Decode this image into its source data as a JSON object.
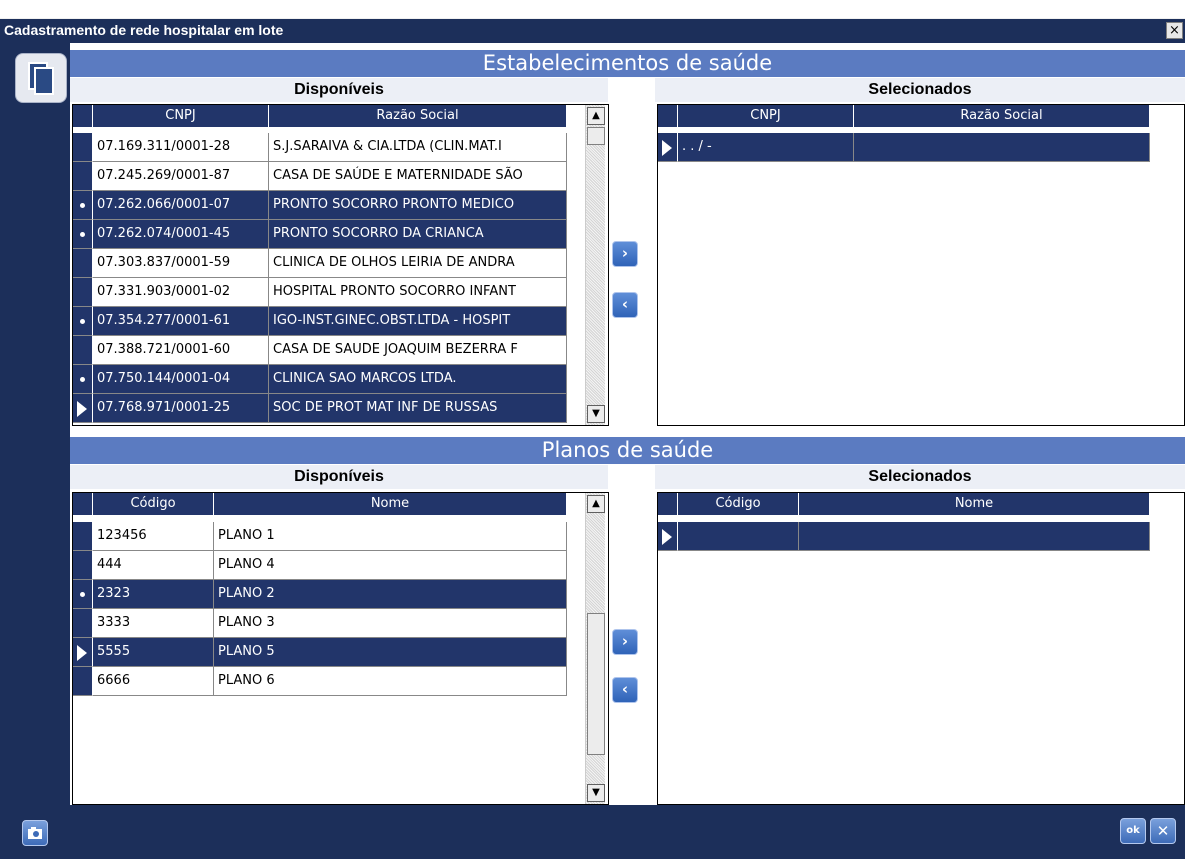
{
  "window": {
    "title": "Cadastramento de rede hospitalar em lote",
    "close_label": "×"
  },
  "estabelecimentos": {
    "title": "Estabelecimentos de saúde",
    "disponiveis": {
      "label": "Disponíveis",
      "columns": [
        "CNPJ",
        "Razão Social"
      ],
      "rows": [
        {
          "cnpj": "07.169.311/0001-28",
          "razao": "S.J.SARAIVA & CIA.LTDA (CLIN.MAT.I"
        },
        {
          "cnpj": "07.245.269/0001-87",
          "razao": "CASA DE SAÚDE E MATERNIDADE SÃO"
        },
        {
          "cnpj": "07.262.066/0001-07",
          "razao": "PRONTO SOCORRO PRONTO MEDICO"
        },
        {
          "cnpj": "07.262.074/0001-45",
          "razao": "PRONTO SOCORRO DA CRIANCA"
        },
        {
          "cnpj": "07.303.837/0001-59",
          "razao": "CLINICA DE OLHOS LEIRIA DE ANDRA"
        },
        {
          "cnpj": "07.331.903/0001-02",
          "razao": "HOSPITAL PRONTO SOCORRO INFANT"
        },
        {
          "cnpj": "07.354.277/0001-61",
          "razao": "IGO-INST.GINEC.OBST.LTDA - HOSPIT"
        },
        {
          "cnpj": "07.388.721/0001-60",
          "razao": "CASA DE SAUDE JOAQUIM BEZERRA F"
        },
        {
          "cnpj": "07.750.144/0001-04",
          "razao": "CLINICA SAO MARCOS LTDA."
        },
        {
          "cnpj": "07.768.971/0001-25",
          "razao": "SOC DE PROT MAT INF DE RUSSAS"
        }
      ]
    },
    "selecionados": {
      "label": "Selecionados",
      "columns": [
        "CNPJ",
        "Razão Social"
      ],
      "rows": [
        {
          "cnpj": " .  .  /  -",
          "razao": ""
        }
      ]
    },
    "add_label": "›",
    "remove_label": "‹"
  },
  "planos": {
    "title": "Planos de saúde",
    "disponiveis": {
      "label": "Disponíveis",
      "columns": [
        "Código",
        "Nome"
      ],
      "rows": [
        {
          "codigo": "123456",
          "nome": "PLANO 1"
        },
        {
          "codigo": "444",
          "nome": "PLANO 4"
        },
        {
          "codigo": "2323",
          "nome": "PLANO 2"
        },
        {
          "codigo": "3333",
          "nome": "PLANO 3"
        },
        {
          "codigo": "5555",
          "nome": "PLANO 5"
        },
        {
          "codigo": "6666",
          "nome": "PLANO 6"
        }
      ]
    },
    "selecionados": {
      "label": "Selecionados",
      "columns": [
        "Código",
        "Nome"
      ],
      "rows": [
        {
          "codigo": "",
          "nome": ""
        }
      ]
    },
    "add_label": "›",
    "remove_label": "‹"
  },
  "footer": {
    "ok_label": "ok",
    "cancel_label": "✕"
  }
}
